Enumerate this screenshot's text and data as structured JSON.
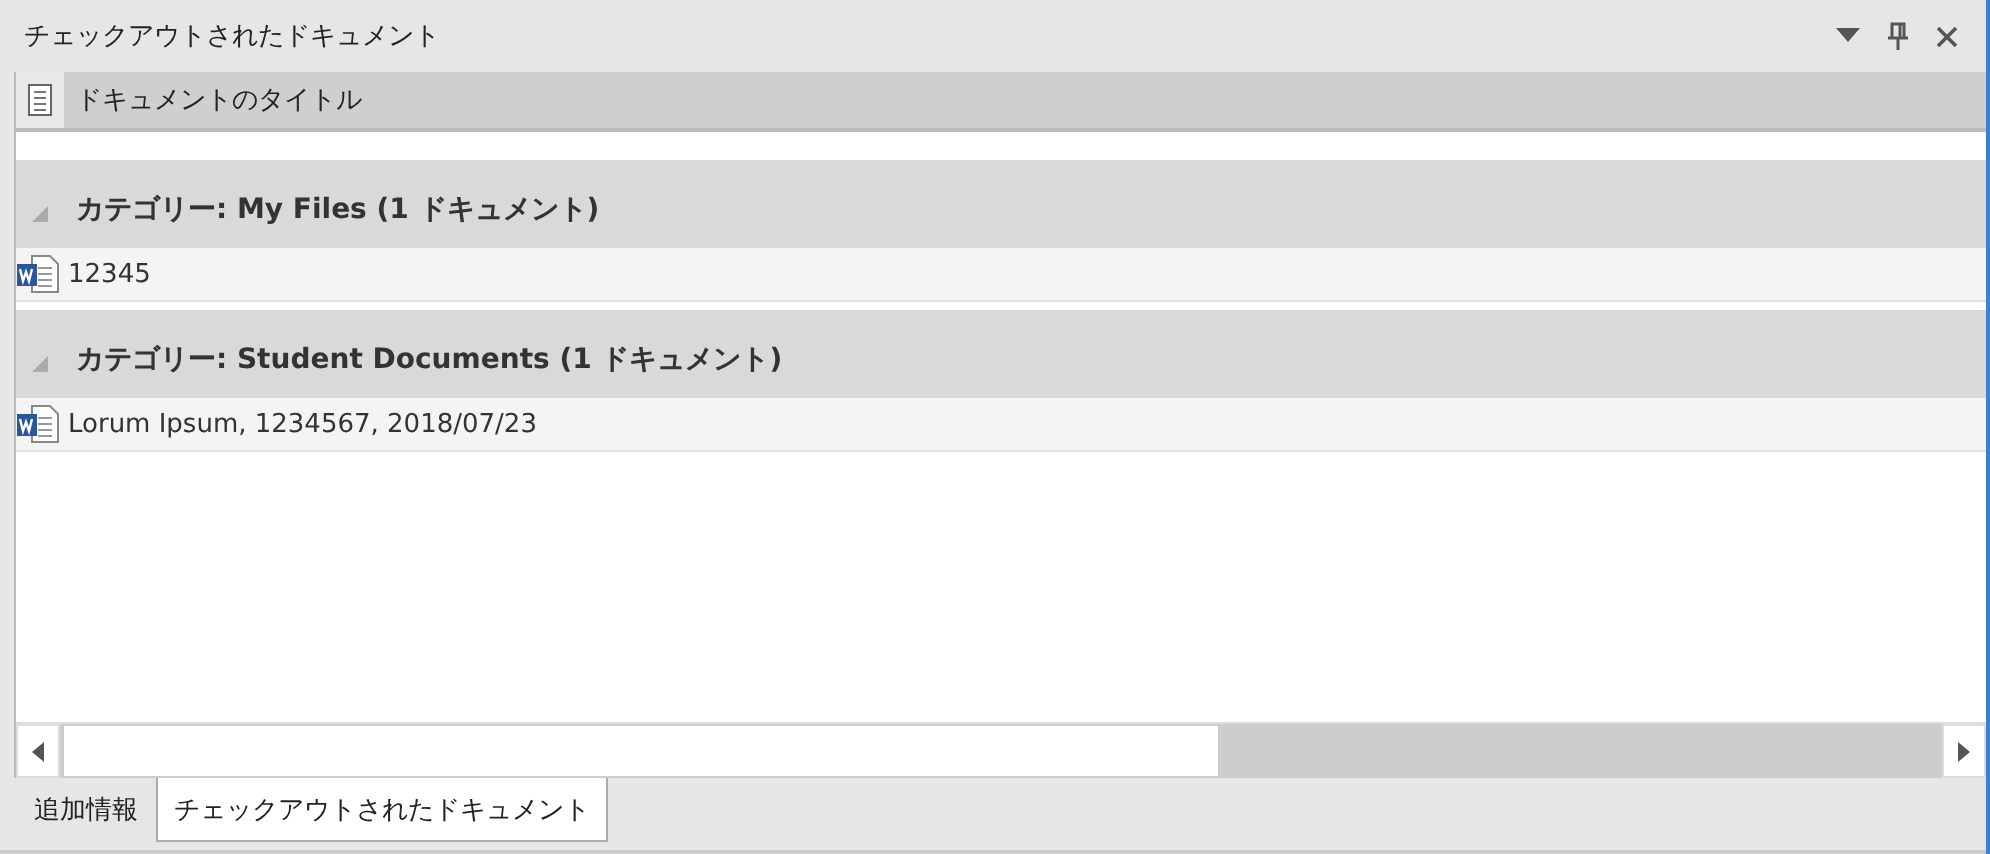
{
  "panel": {
    "title": "チェックアウトされたドキュメント"
  },
  "column_header": {
    "label": "ドキュメントのタイトル"
  },
  "groups": [
    {
      "label": "カテゴリー: My Files (1 ドキュメント)",
      "expanded": true,
      "rows": [
        {
          "title": "12345"
        }
      ]
    },
    {
      "label": "カテゴリー: Student Documents (1 ドキュメント)",
      "expanded": true,
      "rows": [
        {
          "title": "Lorum Ipsum, 1234567, 2018/07/23"
        }
      ]
    }
  ],
  "tabs": [
    {
      "label": "追加情報",
      "selected": false
    },
    {
      "label": "チェックアウトされたドキュメント",
      "selected": true
    }
  ]
}
